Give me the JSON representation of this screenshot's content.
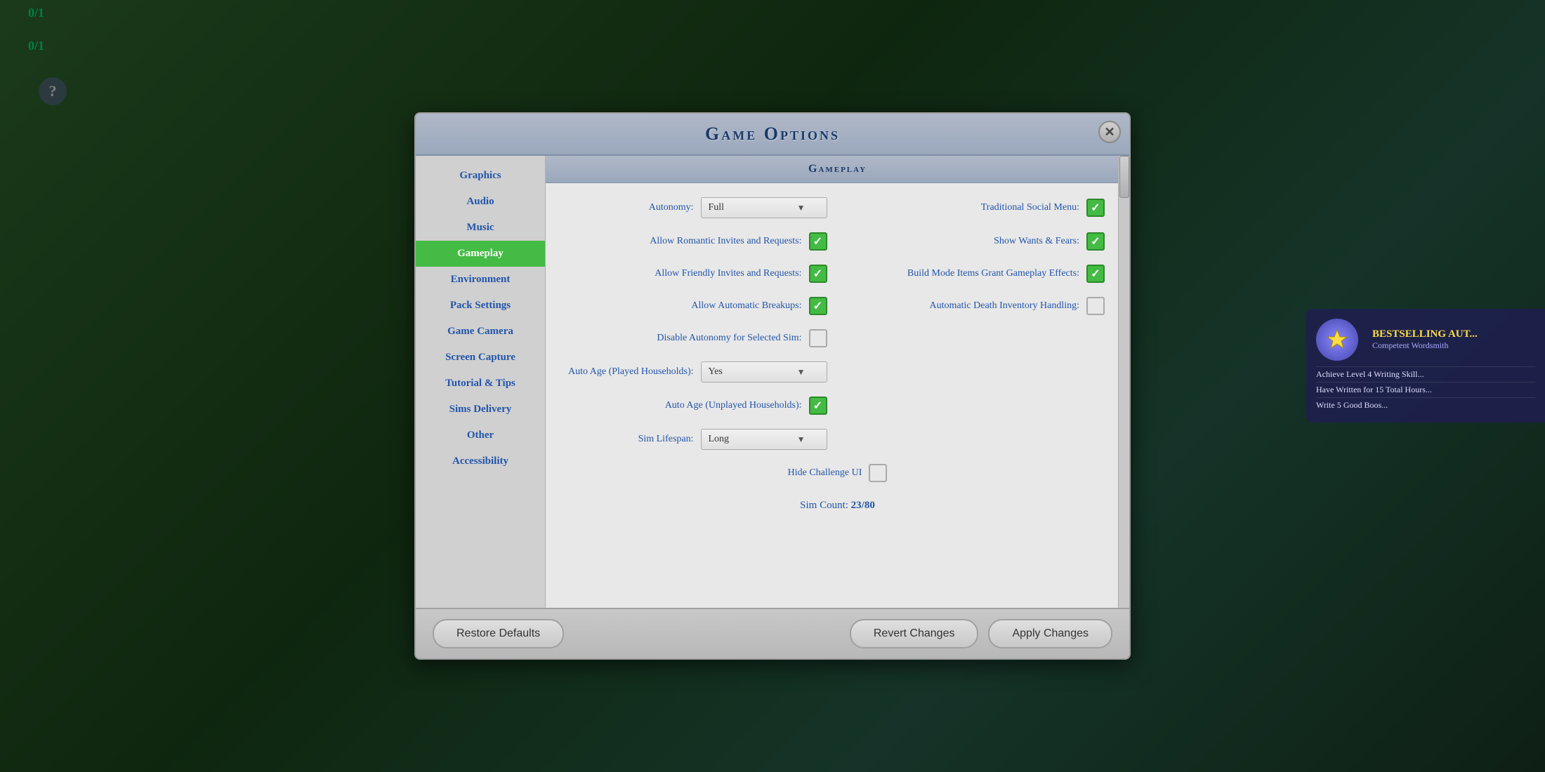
{
  "background": {
    "hud": {
      "number1": "0/1",
      "number2": "0/1",
      "question_mark": "?"
    }
  },
  "modal": {
    "title": "Game Options",
    "close_label": "✕"
  },
  "sidebar": {
    "items": [
      {
        "id": "graphics",
        "label": "Graphics",
        "active": false
      },
      {
        "id": "audio",
        "label": "Audio",
        "active": false
      },
      {
        "id": "music",
        "label": "Music",
        "active": false
      },
      {
        "id": "gameplay",
        "label": "Gameplay",
        "active": true
      },
      {
        "id": "environment",
        "label": "Environment",
        "active": false
      },
      {
        "id": "pack-settings",
        "label": "Pack Settings",
        "active": false
      },
      {
        "id": "game-camera",
        "label": "Game Camera",
        "active": false
      },
      {
        "id": "screen-capture",
        "label": "Screen Capture",
        "active": false
      },
      {
        "id": "tutorial-tips",
        "label": "Tutorial & Tips",
        "active": false
      },
      {
        "id": "sims-delivery",
        "label": "Sims Delivery",
        "active": false
      },
      {
        "id": "other",
        "label": "Other",
        "active": false
      },
      {
        "id": "accessibility",
        "label": "Accessibility",
        "active": false
      }
    ]
  },
  "content": {
    "section_title": "Gameplay",
    "settings": [
      {
        "id": "autonomy",
        "label": "Autonomy:",
        "type": "dropdown",
        "value": "Full",
        "col": "left"
      },
      {
        "id": "traditional-social-menu",
        "label": "Traditional Social Menu:",
        "type": "checkbox",
        "checked": true,
        "col": "right"
      },
      {
        "id": "allow-romantic-invites",
        "label": "Allow Romantic Invites and Requests:",
        "type": "checkbox",
        "checked": true,
        "col": "left"
      },
      {
        "id": "show-wants-fears",
        "label": "Show Wants & Fears:",
        "type": "checkbox",
        "checked": true,
        "col": "right"
      },
      {
        "id": "allow-friendly-invites",
        "label": "Allow Friendly Invites and Requests:",
        "type": "checkbox",
        "checked": true,
        "col": "left"
      },
      {
        "id": "build-mode-items",
        "label": "Build Mode Items Grant Gameplay Effects:",
        "type": "checkbox",
        "checked": true,
        "col": "right"
      },
      {
        "id": "allow-automatic-breakups",
        "label": "Allow Automatic Breakups:",
        "type": "checkbox",
        "checked": true,
        "col": "left"
      },
      {
        "id": "automatic-death-inventory",
        "label": "Automatic Death Inventory Handling:",
        "type": "checkbox",
        "checked": false,
        "col": "right"
      },
      {
        "id": "disable-autonomy-selected",
        "label": "Disable Autonomy for Selected Sim:",
        "type": "checkbox",
        "checked": false,
        "col": "left"
      },
      {
        "id": "placeholder-right",
        "label": "",
        "type": "empty",
        "col": "right"
      },
      {
        "id": "auto-age-played",
        "label": "Auto Age (Played Households):",
        "type": "dropdown",
        "value": "Yes",
        "col": "left"
      },
      {
        "id": "placeholder-right2",
        "label": "",
        "type": "empty",
        "col": "right"
      },
      {
        "id": "auto-age-unplayed",
        "label": "Auto Age (Unplayed Households):",
        "type": "checkbox",
        "checked": true,
        "col": "left"
      },
      {
        "id": "placeholder-right3",
        "label": "",
        "type": "empty",
        "col": "right"
      },
      {
        "id": "sim-lifespan",
        "label": "Sim Lifespan:",
        "type": "dropdown",
        "value": "Long",
        "col": "left"
      },
      {
        "id": "placeholder-right4",
        "label": "",
        "type": "empty",
        "col": "right"
      },
      {
        "id": "hide-challenge-ui",
        "label": "Hide Challenge UI",
        "type": "checkbox-center",
        "checked": false
      }
    ],
    "sim_count_label": "Sim Count:",
    "sim_count_value": "23/80"
  },
  "footer": {
    "restore_defaults": "Restore Defaults",
    "revert_changes": "Revert Changes",
    "apply_changes": "Apply Changes"
  },
  "side_panel": {
    "title": "Bestselling Aut...",
    "subtitle": "Competent Wordsmith",
    "items": [
      "Achieve Level 4 Writing Skill...",
      "Have Written for 15 Total Hours...",
      "Write 5 Good Boos..."
    ]
  }
}
